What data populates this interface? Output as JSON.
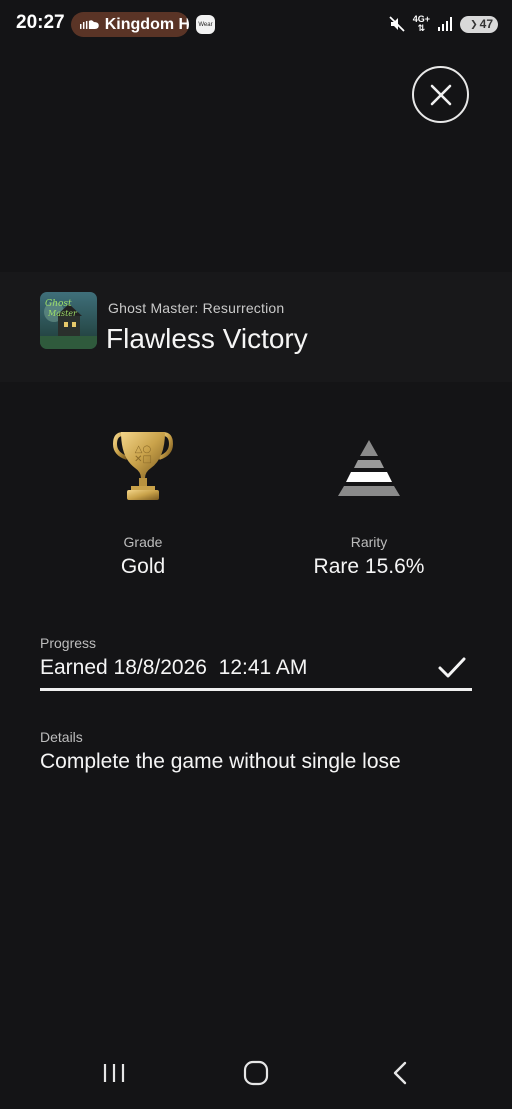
{
  "status_bar": {
    "time": "20:27",
    "media_app": "Kingdom H",
    "wear_label": "Wear",
    "network": "4G+",
    "battery": "47"
  },
  "close": {
    "icon": "close-icon"
  },
  "game": {
    "name": "Ghost Master: Resurrection",
    "thumbnail_icon": "game-cover-thumbnail"
  },
  "trophy": {
    "title": "Flawless Victory",
    "grade_label": "Grade",
    "grade_value": "Gold",
    "grade_icon": "gold-trophy-icon",
    "rarity_label": "Rarity",
    "rarity_value": "Rare 15.6%",
    "rarity_icon": "rarity-pyramid-icon"
  },
  "progress": {
    "label": "Progress",
    "value": "Earned 18/8/2026  12:41 AM",
    "status_icon": "checkmark-icon"
  },
  "details": {
    "label": "Details",
    "value": "Complete the game without single lose"
  },
  "nav": {
    "recents_icon": "recents-icon",
    "home_icon": "home-icon",
    "back_icon": "back-icon"
  },
  "colors": {
    "background": "#141416",
    "header_band": "#18181a",
    "media_pill": "#5a3426",
    "text_primary": "#f5f5f5",
    "text_secondary": "#bdbdbd",
    "trophy_gold": "#c9a24a"
  }
}
